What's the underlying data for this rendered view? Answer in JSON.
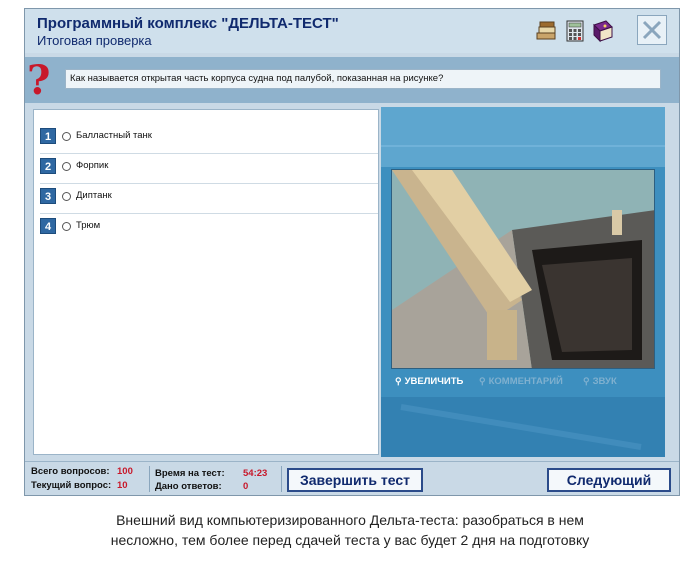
{
  "window": {
    "title": "Программный комплекс \"ДЕЛЬТА-ТЕСТ\"",
    "subtitle": "Итоговая проверка",
    "toolbar_icons": [
      "book-stack-icon",
      "calculator-icon",
      "dictionary-icon",
      "close-icon"
    ]
  },
  "question": {
    "mark": "?",
    "text": "Как называется открытая часть корпуса судна под палубой, показанная на рисунке?"
  },
  "answers": [
    {
      "num": "1",
      "label": "Балластный танк"
    },
    {
      "num": "2",
      "label": "Форпик"
    },
    {
      "num": "3",
      "label": "Диптанк"
    },
    {
      "num": "4",
      "label": "Трюм"
    }
  ],
  "image_panel": {
    "buttons": [
      {
        "label": "УВЕЛИЧИТЬ",
        "icon": "magnifier-icon",
        "enabled": true
      },
      {
        "label": "КОММЕНТАРИЙ",
        "icon": "magnifier-icon",
        "enabled": false
      },
      {
        "label": "ЗВУК",
        "icon": "magnifier-icon",
        "enabled": false
      }
    ]
  },
  "status": {
    "total_label": "Всего вопросов:",
    "total_value": "100",
    "current_label": "Текущий вопрос:",
    "current_value": "10",
    "time_label": "Время на тест:",
    "time_value": "54:23",
    "answered_label": "Дано ответов:",
    "answered_value": "0",
    "finish_button": "Завершить тест",
    "next_button": "Следующий"
  },
  "caption": {
    "line1": "Внешний вид компьютеризированного Дельта-теста: разобраться в нем",
    "line2": "несложно, тем более перед сдачей теста у вас будет 2 дня на подготовку"
  },
  "colors": {
    "accent": "#102a6e",
    "highlight": "#c8182a",
    "panel": "#3d8fbf"
  }
}
